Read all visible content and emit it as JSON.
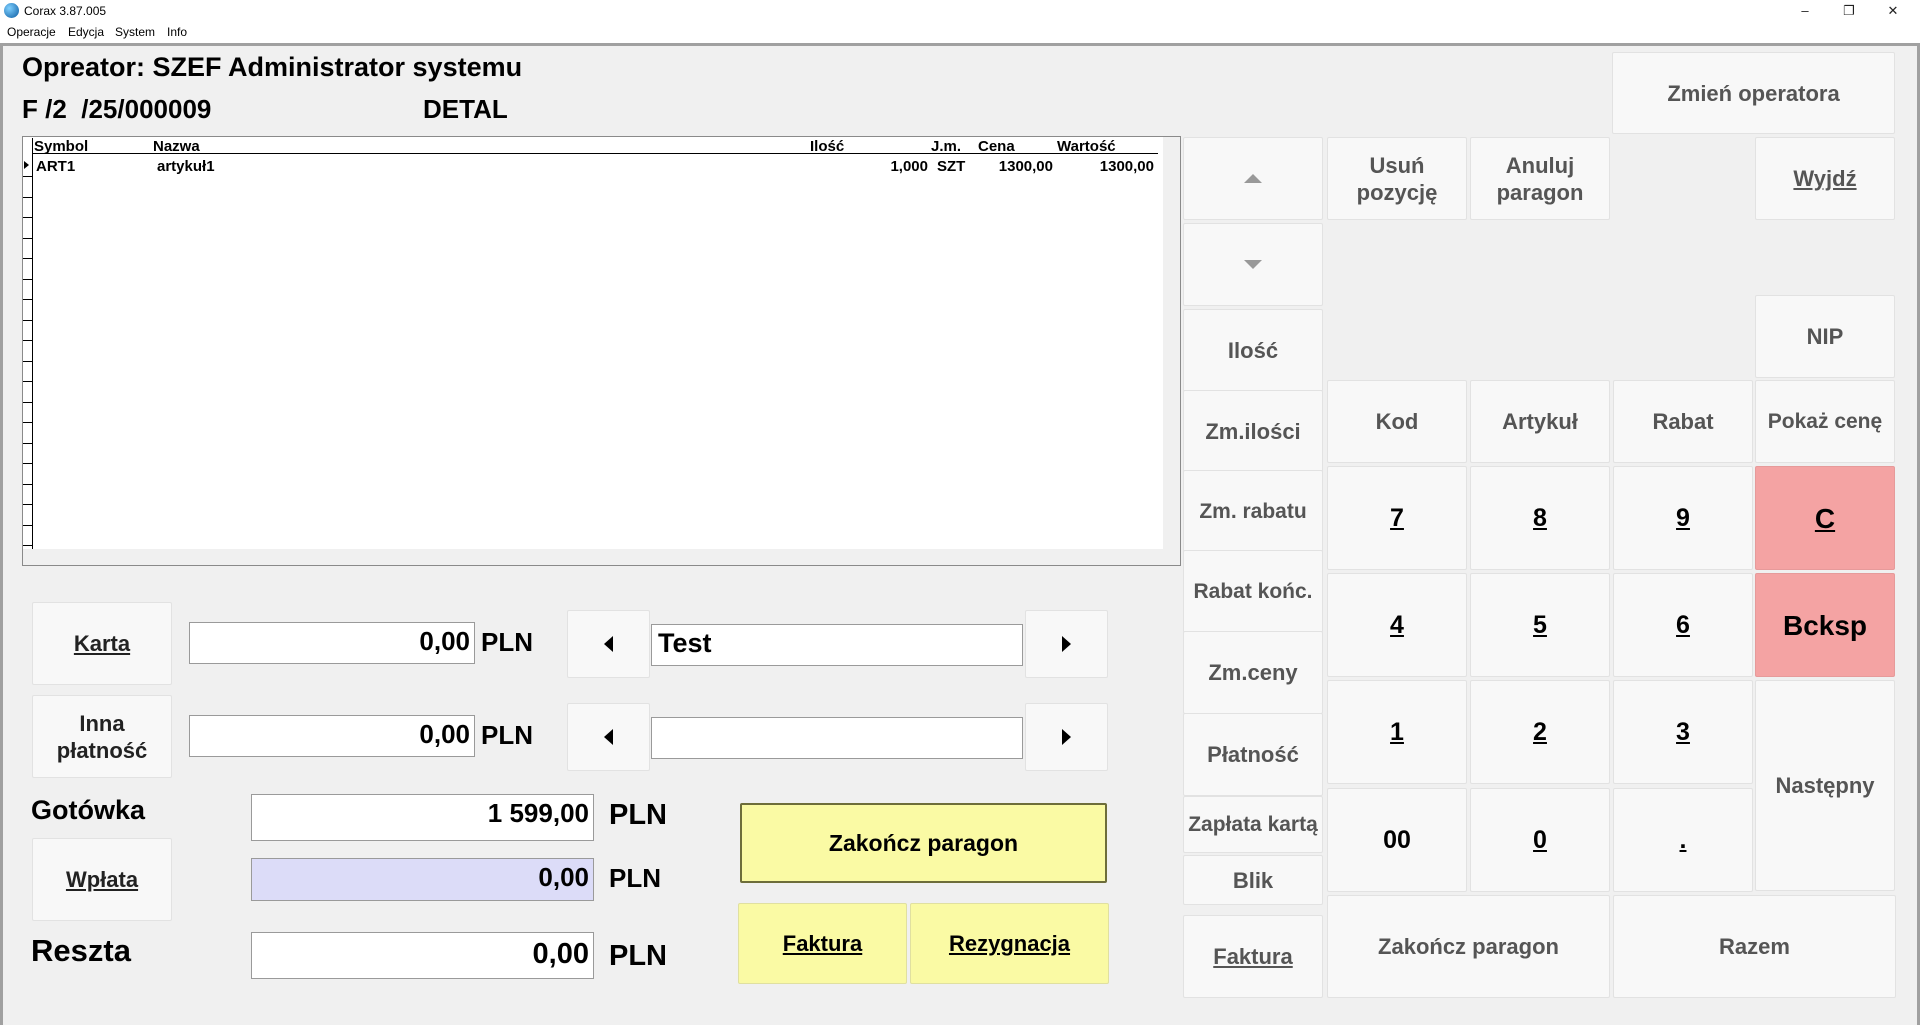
{
  "window": {
    "title": "Corax 3.87.005",
    "minimize": "–",
    "restore": "❐",
    "close": "✕"
  },
  "menu": [
    "Operacje",
    "Edycja",
    "System",
    "Info"
  ],
  "header": {
    "operator": "Opreator: SZEF Administrator systemu",
    "doc_number": "F /2  /25/000009",
    "price_type": "DETAL"
  },
  "grid": {
    "columns": [
      "Symbol",
      "Nazwa",
      "Ilość",
      "J.m.",
      "Cena",
      "Wartość"
    ],
    "rows": [
      {
        "symbol": "ART1",
        "name": "artykuł1",
        "qty": "1,000",
        "unit": "SZT",
        "price": "1300,00",
        "value": "1300,00"
      }
    ]
  },
  "payment": {
    "karta_label": "Karta",
    "karta_value": "0,00",
    "inna_label": "Inna płatność",
    "inna_value": "0,00",
    "currency": "PLN",
    "card_type_value": "Test",
    "other_type_value": "",
    "gotowka_label": "Gotówka",
    "gotowka_value": "1 599,00",
    "wplata_label": "Wpłata",
    "wplata_value": "0,00",
    "reszta_label": "Reszta",
    "reszta_value": "0,00"
  },
  "actions": {
    "finish": "Zakończ paragon",
    "invoice": "Faktura",
    "cancel": "Rezygnacja"
  },
  "keypad": {
    "change_operator": "Zmień operatora",
    "remove_item": "Usuń pozycję",
    "cancel_receipt": "Anuluj paragon",
    "exit": "Wyjdź",
    "nip": "NIP",
    "qty": "Ilość",
    "change_qty": "Zm.ilości",
    "change_discount": "Zm. rabatu",
    "final_discount": "Rabat końc.",
    "change_price": "Zm.ceny",
    "payment": "Płatność",
    "card_payment": "Zapłata kartą",
    "blik": "Blik",
    "invoice": "Faktura",
    "code": "Kod",
    "article": "Artykuł",
    "discount": "Rabat",
    "show_price": "Pokaż cenę",
    "k7": "7",
    "k8": "8",
    "k9": "9",
    "k4": "4",
    "k5": "5",
    "k6": "6",
    "k1": "1",
    "k2": "2",
    "k3": "3",
    "k00": "00",
    "k0": "0",
    "kdot": ".",
    "clear": "C",
    "backspace": "Bcksp",
    "next": "Następny",
    "finish": "Zakończ paragon",
    "total": "Razem"
  },
  "colors": {
    "red_key": "#f4a3a3",
    "yellow_key": "#fafaa4",
    "wplata_field": "#dcdcf8"
  }
}
